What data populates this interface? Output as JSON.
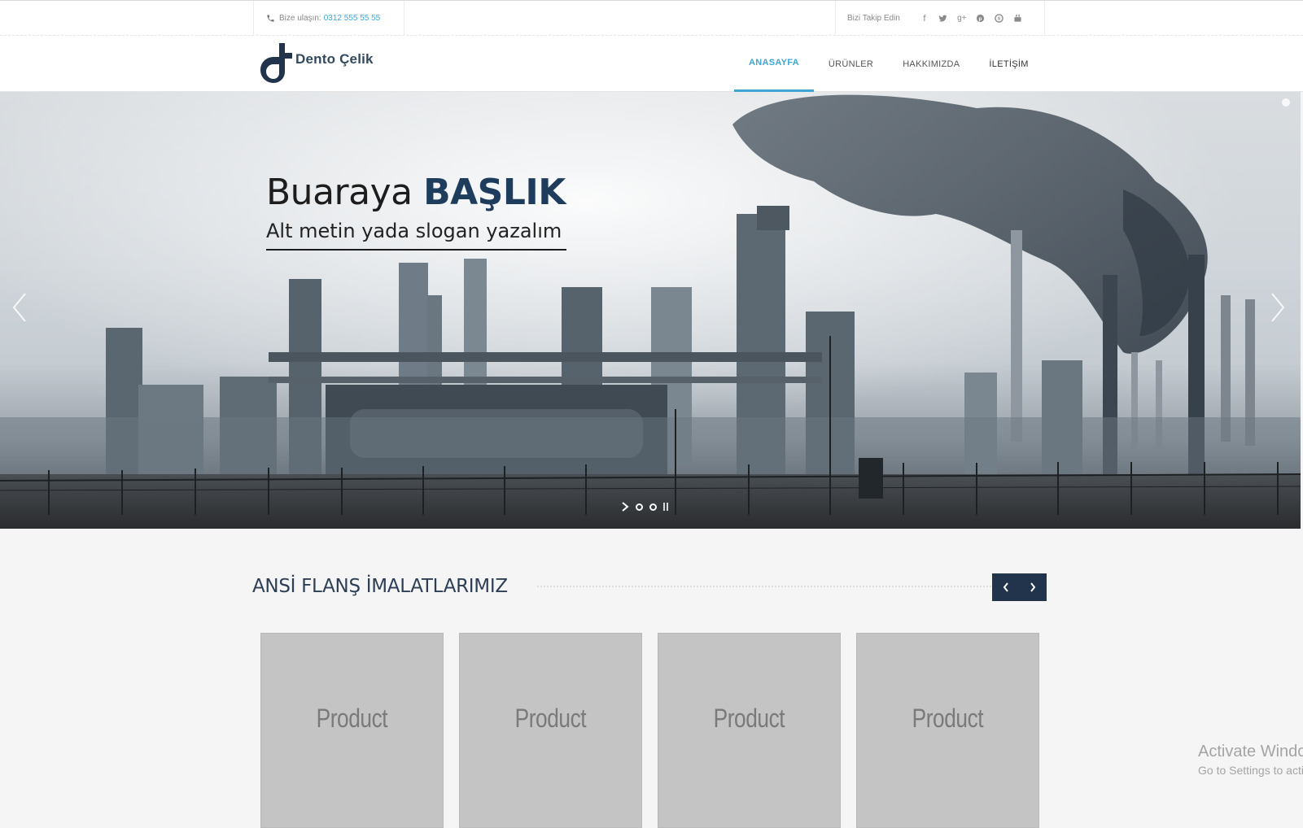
{
  "topbar": {
    "contact_label": "Bize ulaşın:",
    "phone": "0312 555 55 55",
    "follow_label": "Bizi Takip Edin",
    "social_icons": [
      "facebook-icon",
      "twitter-icon",
      "google-plus-icon",
      "pinterest-icon",
      "skype-icon",
      "youtube-icon"
    ]
  },
  "brand": {
    "name": "Dento Çelik",
    "color": "#22344b"
  },
  "nav": {
    "items": [
      {
        "label": "ANASAYFA",
        "active": true
      },
      {
        "label": "ÜRÜNLER",
        "active": false
      },
      {
        "label": "HAKKIMIZDA",
        "active": false
      },
      {
        "label": "İLETİŞİM",
        "active": false
      }
    ],
    "accent": "#3fa6d4"
  },
  "hero": {
    "title_light": "Buaraya",
    "title_bold": "BAŞLIK",
    "subtitle": "Alt metin yada slogan yazalım"
  },
  "products_section": {
    "title": "ANSİ FLANŞ İMALATLARIMIZ",
    "items": [
      "Product",
      "Product",
      "Product",
      "Product"
    ]
  },
  "watermark": {
    "line1": "Activate Windows",
    "line2": "Go to Settings to activate Windows."
  }
}
